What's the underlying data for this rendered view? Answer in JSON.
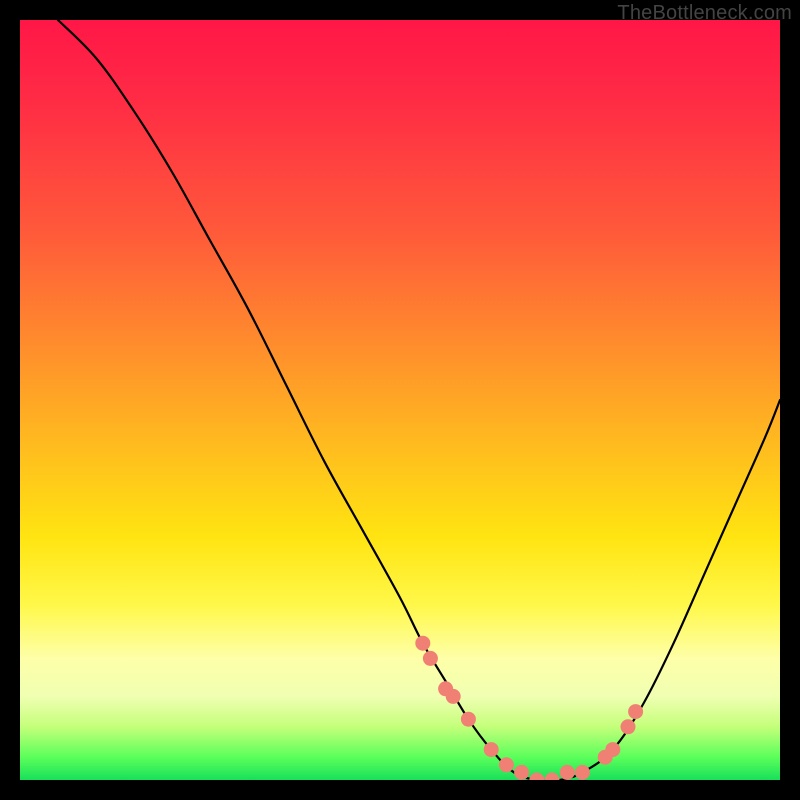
{
  "attribution": "TheBottleneck.com",
  "colors": {
    "curve": "#000000",
    "marker_fill": "#f08074",
    "marker_stroke": "#c25d55",
    "background_black": "#000000"
  },
  "chart_data": {
    "type": "line",
    "title": "",
    "xlabel": "",
    "ylabel": "",
    "xlim": [
      0,
      100
    ],
    "ylim": [
      0,
      100
    ],
    "series": [
      {
        "name": "bottleneck-curve",
        "x": [
          5,
          10,
          15,
          20,
          25,
          30,
          35,
          40,
          45,
          50,
          53,
          56,
          59,
          62,
          65,
          68,
          71,
          74,
          78,
          82,
          86,
          90,
          94,
          98,
          100
        ],
        "y": [
          100,
          95,
          88,
          80,
          71,
          62,
          52,
          42,
          33,
          24,
          18,
          13,
          8,
          4,
          1,
          0,
          0,
          1,
          4,
          10,
          18,
          27,
          36,
          45,
          50
        ]
      }
    ],
    "markers": {
      "name": "highlighted-points",
      "x": [
        53,
        54,
        56,
        57,
        59,
        62,
        64,
        66,
        68,
        70,
        72,
        74,
        77,
        78,
        80,
        81
      ],
      "y": [
        18,
        16,
        12,
        11,
        8,
        4,
        2,
        1,
        0,
        0,
        1,
        1,
        3,
        4,
        7,
        9
      ]
    }
  }
}
